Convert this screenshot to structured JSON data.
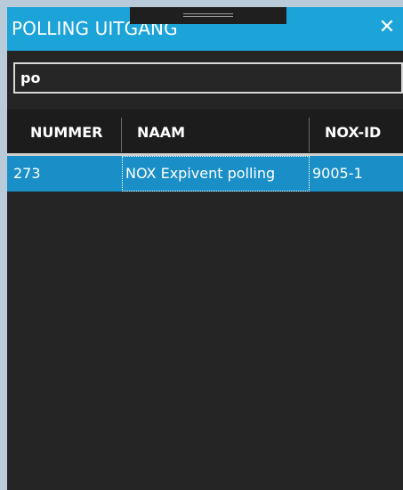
{
  "window": {
    "title": "POLLING UITGANG",
    "close_glyph": "✕"
  },
  "search": {
    "value": "po"
  },
  "table": {
    "columns": [
      "NUMMER",
      "NAAM",
      "NOX-ID"
    ],
    "rows": [
      {
        "nummer": "273",
        "naam": "NOX Expivent polling",
        "nox_id": "9005-1",
        "selected": true
      }
    ]
  },
  "colors": {
    "header_bg": "#1ca3d8",
    "panel_bg": "#252525",
    "selected_row_bg": "#1a8fc7",
    "outer_bg": "#b9cbd9"
  }
}
